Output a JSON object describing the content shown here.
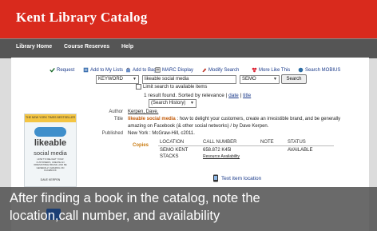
{
  "banner": {
    "title": "Kent Library Catalog"
  },
  "nav": {
    "items": [
      "Library Home",
      "Course Reserves",
      "Help"
    ]
  },
  "toolbar": {
    "items": [
      {
        "label": "Request",
        "icon": "request-icon"
      },
      {
        "label": "Add to My Lists",
        "icon": "list-icon"
      },
      {
        "label": "Add to Bag",
        "icon": "bag-icon"
      },
      {
        "label": "MARC Display",
        "icon": "marc-icon"
      },
      {
        "label": "Modify Search",
        "icon": "modify-icon"
      },
      {
        "label": "More Like This",
        "icon": "more-icon"
      },
      {
        "label": "Search MOBIUS",
        "icon": "mobius-icon"
      }
    ]
  },
  "search": {
    "type_value": "KEYWORD",
    "query_value": "likeable social media",
    "scope_value": "SEMO",
    "search_button": "Search",
    "limit_label": "Limit search to available items",
    "result_text": "1 result found. Sorted by relevance |",
    "sort_date": "date",
    "sort_title": "title",
    "location_value": "(Search History)"
  },
  "record": {
    "author_label": "Author",
    "author_value": "Kerpen, Dave.",
    "title_label": "Title",
    "title_highlight": "likeable social media",
    "title_line1_rest": ": how to delight your customers, create an irresistible brand, and be generally",
    "title_line2": "amazing on Facebook (& other social networks) / by Dave Kerpen.",
    "published_label": "Published",
    "published_value": "New York : McGraw-Hill, c2011."
  },
  "cover": {
    "top_text": "THE NEW YORK TIMES BESTSELLER",
    "title_1": "likeable",
    "title_2": "social media",
    "subtitle": "HOW TO DELIGHT YOUR CUSTOMERS, CREATE AN IRRESISTIBLE BRAND, AND BE GENERALLY AMAZING ON FACEBOOK",
    "author": "DAVE KERPEN"
  },
  "copies": {
    "label": "Copies",
    "headers": [
      "LOCATION",
      "CALL NUMBER",
      "NOTE",
      "STATUS"
    ],
    "rows": [
      {
        "location": "SEMO KENT",
        "call_number": "658.872 K45l",
        "note": "",
        "status": "AVAILABLE"
      }
    ],
    "stacks_label": "STACKS",
    "resource_link": "Resource Availability",
    "text_item_location": "Text item location"
  },
  "caption": {
    "line1": "After finding a book in the catalog, note the",
    "line2": "location,call number, and availability"
  },
  "colors": {
    "banner": "#d92a1d",
    "nav": "#555555",
    "link": "#1a3a8a",
    "caption_bg": "#505050"
  }
}
